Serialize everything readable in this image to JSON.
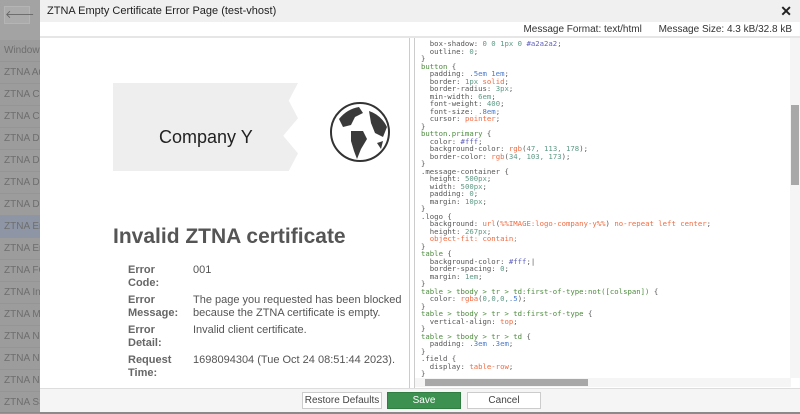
{
  "background_list": {
    "back_icon": "arrow-left",
    "items": [
      "Window",
      "ZTNA Au",
      "ZTNA Ca",
      "ZTNA Cl",
      "ZTNA De",
      "ZTNA De",
      "ZTNA De",
      "ZTNA De",
      "ZTNA Em",
      "ZTNA Em",
      "ZTNA FC",
      "ZTNA In",
      "ZTNA M",
      "ZTNA No",
      "ZTNA No",
      "ZTNA No",
      "ZTNA SS"
    ],
    "selected_index": 8
  },
  "modal": {
    "title": "ZTNA Empty Certificate Error Page (test-vhost)",
    "close": "✕",
    "message_format": "Message Format: text/html",
    "message_size": "Message Size: 4.3 kB/32.8 kB"
  },
  "preview": {
    "logo_text": "Company Y",
    "heading": "Invalid ZTNA certificate",
    "rows": [
      {
        "label": "Error Code:",
        "value": "001"
      },
      {
        "label": "Error Message:",
        "value": "The page you requested has been blocked because the ZTNA certificate is empty."
      },
      {
        "label": "Error Detail:",
        "value": "Invalid client certificate."
      },
      {
        "label": "Request Time:",
        "value": "1698094304 (Tue Oct 24 08:51:44 2023)."
      }
    ]
  },
  "code_lines": [
    [
      [
        "  box-shadow: ",
        ""
      ],
      [
        "0 0 1px 0 ",
        "n"
      ],
      [
        "#a2a2a2",
        "p"
      ],
      [
        ";",
        ""
      ]
    ],
    [
      [
        "  outline: ",
        ""
      ],
      [
        "0",
        "n"
      ],
      [
        ";",
        ""
      ]
    ],
    [
      [
        "}",
        ""
      ]
    ],
    [
      [
        "button",
        "s"
      ],
      [
        " {",
        ""
      ]
    ],
    [
      [
        "  padding: ",
        ""
      ],
      [
        ".5em 1em",
        "b"
      ],
      [
        ";",
        ""
      ]
    ],
    [
      [
        "  border: ",
        ""
      ],
      [
        "1px ",
        "n"
      ],
      [
        "solid",
        "k"
      ],
      [
        ";",
        ""
      ]
    ],
    [
      [
        "  border-radius: ",
        ""
      ],
      [
        "3px",
        "n"
      ],
      [
        ";",
        ""
      ]
    ],
    [
      [
        "  min-width: ",
        ""
      ],
      [
        "6em",
        "n"
      ],
      [
        ";",
        ""
      ]
    ],
    [
      [
        "  font-weight: ",
        ""
      ],
      [
        "400",
        "n"
      ],
      [
        ";",
        ""
      ]
    ],
    [
      [
        "  font-size: ",
        ""
      ],
      [
        ".8em",
        "b"
      ],
      [
        ";",
        ""
      ]
    ],
    [
      [
        "  cursor: ",
        ""
      ],
      [
        "pointer",
        "k"
      ],
      [
        ";",
        ""
      ]
    ],
    [
      [
        "}",
        ""
      ]
    ],
    [
      [
        "button.primary",
        "s"
      ],
      [
        " {",
        ""
      ]
    ],
    [
      [
        "  color: ",
        ""
      ],
      [
        "#fff",
        "p"
      ],
      [
        ";",
        ""
      ]
    ],
    [
      [
        "  background-color: ",
        ""
      ],
      [
        "rgb",
        "k"
      ],
      [
        "(",
        ""
      ],
      [
        "47, 113, 178",
        "n"
      ],
      [
        ");",
        ""
      ]
    ],
    [
      [
        "  border-color: ",
        ""
      ],
      [
        "rgb",
        "k"
      ],
      [
        "(",
        ""
      ],
      [
        "34, 103, 173",
        "n"
      ],
      [
        ");",
        ""
      ]
    ],
    [
      [
        "}",
        ""
      ]
    ],
    [
      [
        ".message-container {",
        ""
      ]
    ],
    [
      [
        "  height: ",
        ""
      ],
      [
        "500px",
        "n"
      ],
      [
        ";",
        ""
      ]
    ],
    [
      [
        "  width: ",
        ""
      ],
      [
        "500px",
        "n"
      ],
      [
        ";",
        ""
      ]
    ],
    [
      [
        "  padding: ",
        ""
      ],
      [
        "0",
        "n"
      ],
      [
        ";",
        ""
      ]
    ],
    [
      [
        "  margin: ",
        ""
      ],
      [
        "10px",
        "n"
      ],
      [
        ";",
        ""
      ]
    ],
    [
      [
        "}",
        ""
      ]
    ],
    [
      [
        ".logo {",
        ""
      ]
    ],
    [
      [
        "  background: ",
        ""
      ],
      [
        "url",
        "k"
      ],
      [
        "(",
        ""
      ],
      [
        "%%IMAGE:logo-company-y%%",
        "k"
      ],
      [
        ") ",
        ""
      ],
      [
        "no-repeat left center",
        "k"
      ],
      [
        ";",
        ""
      ]
    ],
    [
      [
        "  height: ",
        ""
      ],
      [
        "267px",
        "n"
      ],
      [
        ";",
        ""
      ]
    ],
    [
      [
        "  object-fit: contain;",
        "k"
      ]
    ],
    [
      [
        "}",
        ""
      ]
    ],
    [
      [
        "table",
        "s"
      ],
      [
        " {",
        ""
      ]
    ],
    [
      [
        "  background-color: ",
        ""
      ],
      [
        "#fff",
        "p"
      ],
      [
        ";|",
        ""
      ]
    ],
    [
      [
        "  border-spacing: ",
        ""
      ],
      [
        "0",
        "n"
      ],
      [
        ";",
        ""
      ]
    ],
    [
      [
        "  margin: ",
        ""
      ],
      [
        "1em",
        "n"
      ],
      [
        ";",
        ""
      ]
    ],
    [
      [
        "}",
        ""
      ]
    ],
    [
      [
        "table > tbody > tr > td:first-of-type:not([colspan])",
        "s"
      ],
      [
        " {",
        ""
      ]
    ],
    [
      [
        "  color: ",
        ""
      ],
      [
        "rgba",
        "k"
      ],
      [
        "(",
        ""
      ],
      [
        "0,0,0,",
        "n"
      ],
      [
        ".5",
        "b"
      ],
      [
        ");",
        ""
      ]
    ],
    [
      [
        "}",
        ""
      ]
    ],
    [
      [
        "table > tbody > tr > td:first-of-type",
        "s"
      ],
      [
        " {",
        ""
      ]
    ],
    [
      [
        "  vertical-align: ",
        ""
      ],
      [
        "top",
        "k"
      ],
      [
        ";",
        ""
      ]
    ],
    [
      [
        "}",
        ""
      ]
    ],
    [
      [
        "table > tbody > tr > td",
        "s"
      ],
      [
        " {",
        ""
      ]
    ],
    [
      [
        "  padding: ",
        ""
      ],
      [
        ".3em .3em",
        "b"
      ],
      [
        ";",
        ""
      ]
    ],
    [
      [
        "}",
        ""
      ]
    ],
    [
      [
        ".field {",
        ""
      ]
    ],
    [
      [
        "  display: ",
        ""
      ],
      [
        "table-row",
        "k"
      ],
      [
        ";",
        ""
      ]
    ],
    [
      [
        "}",
        ""
      ]
    ]
  ],
  "footer": {
    "restore": "Restore Defaults",
    "save": "Save",
    "cancel": "Cancel"
  }
}
